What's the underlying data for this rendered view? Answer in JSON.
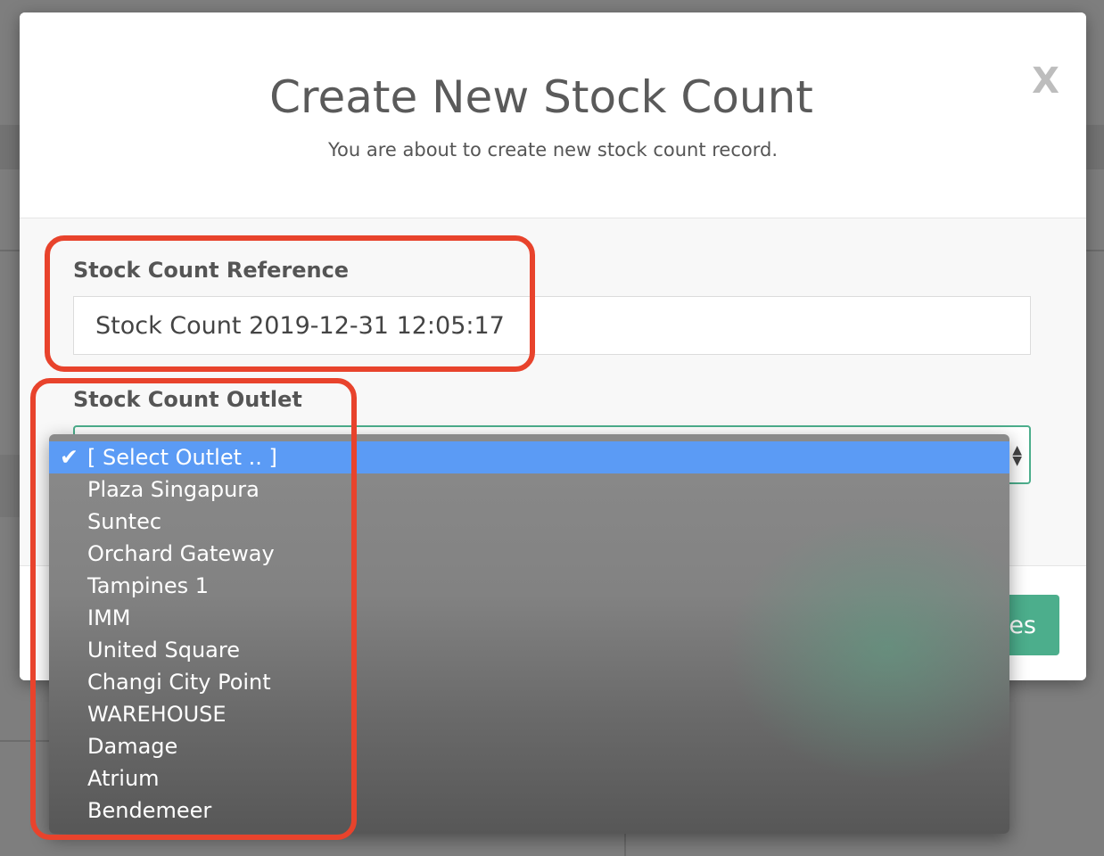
{
  "modal": {
    "title": "Create New Stock Count",
    "subtitle": "You are about to create new stock count record.",
    "close_label": "X"
  },
  "form": {
    "reference_label": "Stock Count Reference",
    "reference_value": "Stock Count 2019-12-31 12:05:17",
    "outlet_label": "Stock Count Outlet"
  },
  "footer": {
    "save_label_partial": "es"
  },
  "dropdown": {
    "selected_index": 0,
    "options": [
      "[ Select Outlet .. ]",
      "Plaza Singapura",
      "Suntec",
      "Orchard Gateway",
      "Tampines 1",
      "IMM",
      "United Square",
      "Changi City Point",
      "WAREHOUSE",
      "Damage",
      "Atrium",
      "Bendemeer"
    ]
  },
  "colors": {
    "accent_green": "#4cae8c",
    "highlight_red": "#e8432c",
    "selected_blue": "#5b9bf5"
  },
  "icons": {
    "check": "check-icon",
    "select_arrows": "chevron-updown-icon"
  }
}
